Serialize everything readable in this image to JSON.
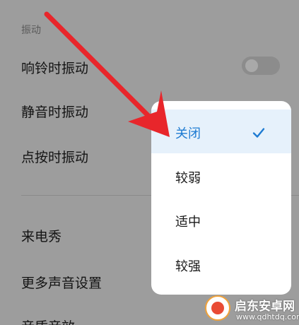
{
  "settings": {
    "section_label": "振动",
    "rows": [
      {
        "label": "响铃时振动"
      },
      {
        "label": "静音时振动"
      },
      {
        "label": "点按时振动"
      },
      {
        "label": "来电秀"
      },
      {
        "label": "更多声音设置"
      },
      {
        "label": "音质音效"
      }
    ],
    "ring_vibrate_toggle": {
      "on": false
    }
  },
  "popup": {
    "options": [
      {
        "label": "关闭",
        "selected": true
      },
      {
        "label": "较弱",
        "selected": false
      },
      {
        "label": "适中",
        "selected": false
      },
      {
        "label": "较强",
        "selected": false
      }
    ]
  },
  "annotation": {
    "arrow_color": "#e8262b",
    "icon": "arrow-icon"
  },
  "watermark": {
    "title": "启东安卓网",
    "url": "www.qdhtdq.com"
  },
  "colors": {
    "accent": "#1e7bd2",
    "selected_bg": "#e6f1fb",
    "overlay_bg": "#9d9d9d",
    "popup_bg": "#ffffff"
  }
}
